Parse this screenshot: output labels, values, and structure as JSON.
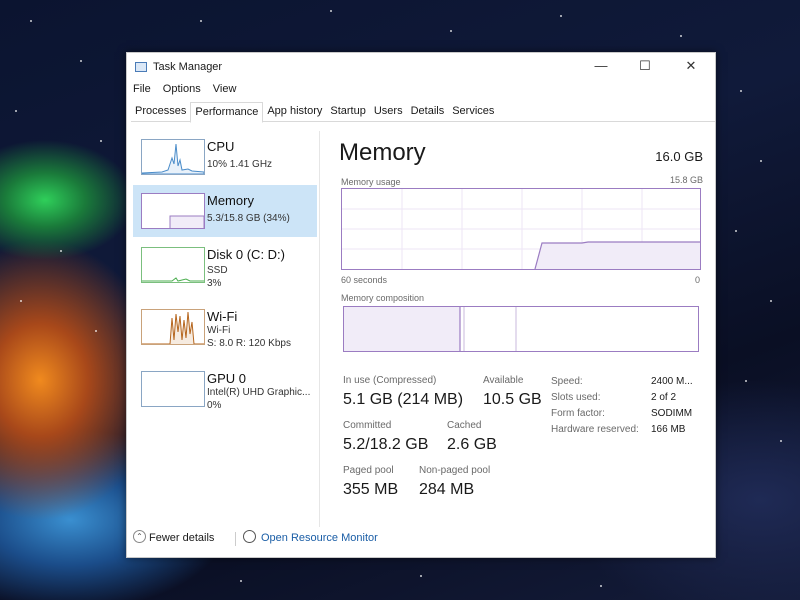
{
  "window": {
    "title": "Task Manager",
    "controls": {
      "minimize": "—",
      "maximize": "☐",
      "close": "✕"
    }
  },
  "menu": [
    "File",
    "Options",
    "View"
  ],
  "tabs": [
    "Processes",
    "Performance",
    "App history",
    "Startup",
    "Users",
    "Details",
    "Services"
  ],
  "active_tab": "Performance",
  "sidebar": {
    "items": [
      {
        "name": "CPU",
        "line1": "10%  1.41 GHz",
        "line2": "",
        "line3": ""
      },
      {
        "name": "Memory",
        "line1": "5.3/15.8 GB (34%)",
        "line2": "",
        "line3": ""
      },
      {
        "name": "Disk 0 (C: D:)",
        "line1": "SSD",
        "line2": "3%",
        "line3": ""
      },
      {
        "name": "Wi-Fi",
        "line1": "Wi-Fi",
        "line2": "S: 8.0  R: 120 Kbps",
        "line3": ""
      },
      {
        "name": "GPU 0",
        "line1": "Intel(R) UHD Graphic...",
        "line2": "0%",
        "line3": ""
      }
    ],
    "selected_index": 1
  },
  "main": {
    "title": "Memory",
    "total": "16.0 GB",
    "usage_label": "Memory usage",
    "usage_max": "15.8 GB",
    "time_left": "60 seconds",
    "time_right": "0",
    "composition_label": "Memory composition",
    "stats": {
      "in_use_label": "In use (Compressed)",
      "in_use_value": "5.1 GB (214 MB)",
      "available_label": "Available",
      "available_value": "10.5 GB",
      "committed_label": "Committed",
      "committed_value": "5.2/18.2 GB",
      "cached_label": "Cached",
      "cached_value": "2.6 GB",
      "paged_label": "Paged pool",
      "paged_value": "355 MB",
      "nonpaged_label": "Non-paged pool",
      "nonpaged_value": "284 MB"
    },
    "details": [
      {
        "key": "Speed:",
        "value": "2400 M..."
      },
      {
        "key": "Slots used:",
        "value": "2 of 2"
      },
      {
        "key": "Form factor:",
        "value": "SODIMM"
      },
      {
        "key": "Hardware reserved:",
        "value": "166 MB"
      }
    ]
  },
  "footer": {
    "fewer_details": "Fewer details",
    "open_resource_monitor": "Open Resource Monitor"
  },
  "colors": {
    "memory_accent": "#9b7cc2",
    "memory_fill": "#f1ecf8",
    "selected_bg": "#cce4f7",
    "cpu_line": "#4a8cc9",
    "disk_line": "#4caf50",
    "wifi_line": "#b5651d"
  }
}
